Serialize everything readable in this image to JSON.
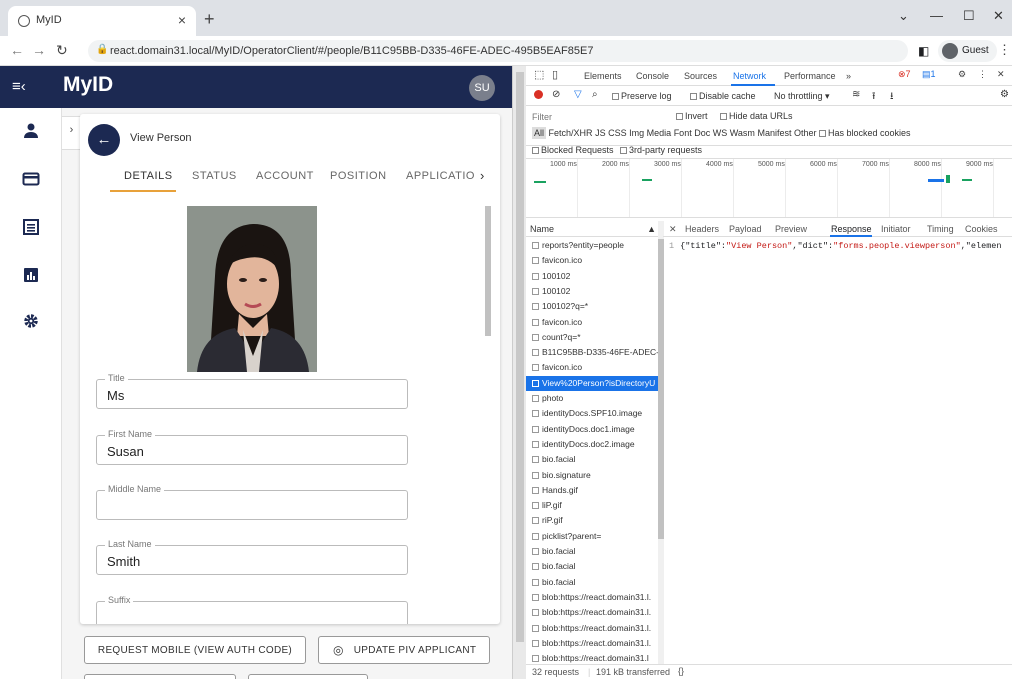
{
  "browser": {
    "tab_title": "MyID",
    "url": "react.domain31.local/MyID/OperatorClient/#/people/B11C95BB-D335-46FE-ADEC-495B5EAF85E7",
    "profile_label": "Guest"
  },
  "app": {
    "brand": "MyID",
    "user_initials": "SU",
    "page_title": "View Person",
    "tabs": [
      "DETAILS",
      "STATUS",
      "ACCOUNT",
      "POSITION",
      "APPLICATIO"
    ],
    "active_tab": "DETAILS",
    "fields": [
      {
        "label": "Title",
        "value": "Ms"
      },
      {
        "label": "First Name",
        "value": "Susan"
      },
      {
        "label": "Middle Name",
        "value": ""
      },
      {
        "label": "Last Name",
        "value": "Smith"
      },
      {
        "label": "Suffix",
        "value": ""
      }
    ],
    "buttons": {
      "request_mobile": "REQUEST MOBILE (VIEW AUTH CODE)",
      "update_piv": "UPDATE PIV APPLICANT"
    }
  },
  "devtools": {
    "tabs": [
      "Elements",
      "Console",
      "Sources",
      "Network",
      "Performance",
      "»"
    ],
    "active_tab": "Network",
    "error_count": "7",
    "message_count": "1",
    "toolbar": {
      "preserve_log": "Preserve log",
      "disable_cache": "Disable cache",
      "throttling": "No throttling"
    },
    "filter": {
      "placeholder": "Filter",
      "invert": "Invert",
      "hide_data_urls": "Hide data URLs",
      "types": [
        "All",
        "Fetch/XHR",
        "JS",
        "CSS",
        "Img",
        "Media",
        "Font",
        "Doc",
        "WS",
        "Wasm",
        "Manifest",
        "Other"
      ],
      "has_blocked_cookies": "Has blocked cookies",
      "blocked_requests": "Blocked Requests",
      "third_party": "3rd-party requests"
    },
    "timeline_ticks": [
      "1000 ms",
      "2000 ms",
      "3000 ms",
      "4000 ms",
      "5000 ms",
      "6000 ms",
      "7000 ms",
      "8000 ms",
      "9000 ms"
    ],
    "name_header": "Name",
    "requests": [
      "reports?entity=people",
      "favicon.ico",
      "100102",
      "100102",
      "100102?q=*",
      "favicon.ico",
      "count?q=*",
      "B11C95BB-D335-46FE-ADEC-",
      "favicon.ico",
      "View%20Person?isDirectoryU",
      "photo",
      "identityDocs.SPF10.image",
      "identityDocs.doc1.image",
      "identityDocs.doc2.image",
      "bio.facial",
      "bio.signature",
      "Hands.gif",
      "liP.gif",
      "riP.gif",
      "picklist?parent=",
      "bio.facial",
      "bio.facial",
      "bio.facial",
      "blob:https://react.domain31.l.",
      "blob:https://react.domain31.l.",
      "blob:https://react.domain31.l.",
      "blob:https://react.domain31.l.",
      "blob:https://react.domain31.l"
    ],
    "selected_request_index": 9,
    "detail_tabs": [
      "Headers",
      "Payload",
      "Preview",
      "Response",
      "Initiator",
      "Timing",
      "Cookies"
    ],
    "active_detail_tab": "Response",
    "response": {
      "line_number": "1",
      "text_prefix": "{\"title\":",
      "title_value": "\"View Person\"",
      "mid": ",\"dict\":",
      "dict_value": "\"forms.people.viewperson\"",
      "suffix": ",\"elemen"
    },
    "status": {
      "requests": "32 requests",
      "transferred": "191 kB transferred",
      "braces": "{}"
    }
  }
}
